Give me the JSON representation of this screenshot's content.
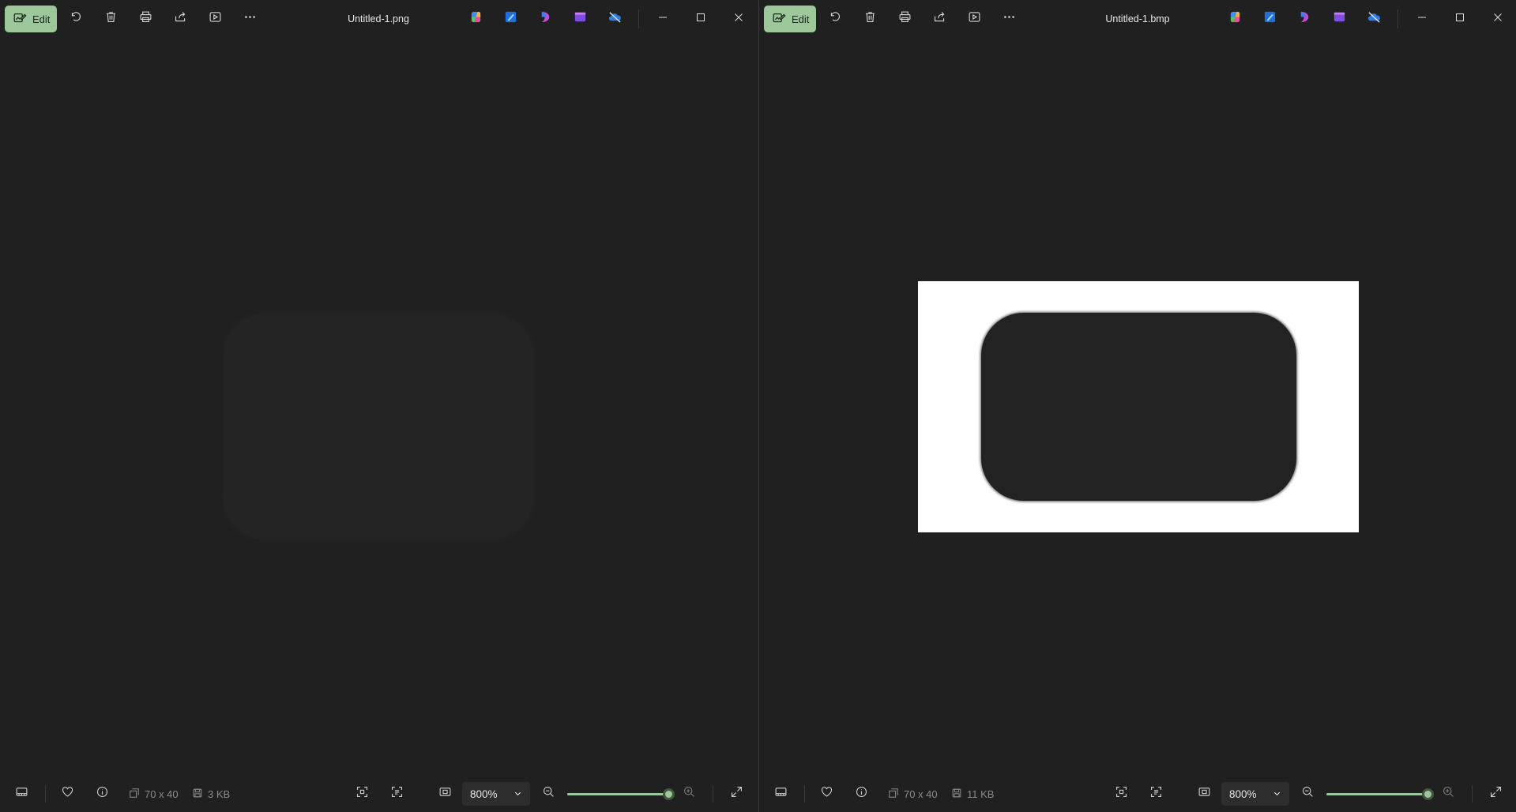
{
  "colors": {
    "accent": "#9cc79a",
    "background": "#202020",
    "image_bg": "#ffffff",
    "shape": "#222222"
  },
  "windows": [
    {
      "id": "left",
      "edit_label": "Edit",
      "title": "Untitled-1.png",
      "dimensions": "70 x 40",
      "file_size": "3 KB",
      "zoom": "800%",
      "zoom_level": 1.0,
      "shows_white_background": false
    },
    {
      "id": "right",
      "edit_label": "Edit",
      "title": "Untitled-1.bmp",
      "dimensions": "70 x 40",
      "file_size": "11 KB",
      "zoom": "800%",
      "zoom_level": 1.0,
      "shows_white_background": true
    }
  ],
  "toolbar_icons": [
    "edit-icon",
    "rotate-icon",
    "delete-icon",
    "print-icon",
    "share-icon",
    "slideshow-icon",
    "more-icon"
  ],
  "app_icons": [
    "copilot-icon",
    "designer-icon",
    "clipchamp-icon",
    "video-editor-icon",
    "onedrive-icon"
  ],
  "bottom_icons": [
    "filmstrip-icon",
    "favorite-icon",
    "info-icon",
    "dimensions-icon",
    "filesize-icon",
    "fit-to-window-icon",
    "ocr-icon",
    "actual-size-icon",
    "zoom-out-icon",
    "zoom-in-icon",
    "fullscreen-icon"
  ]
}
